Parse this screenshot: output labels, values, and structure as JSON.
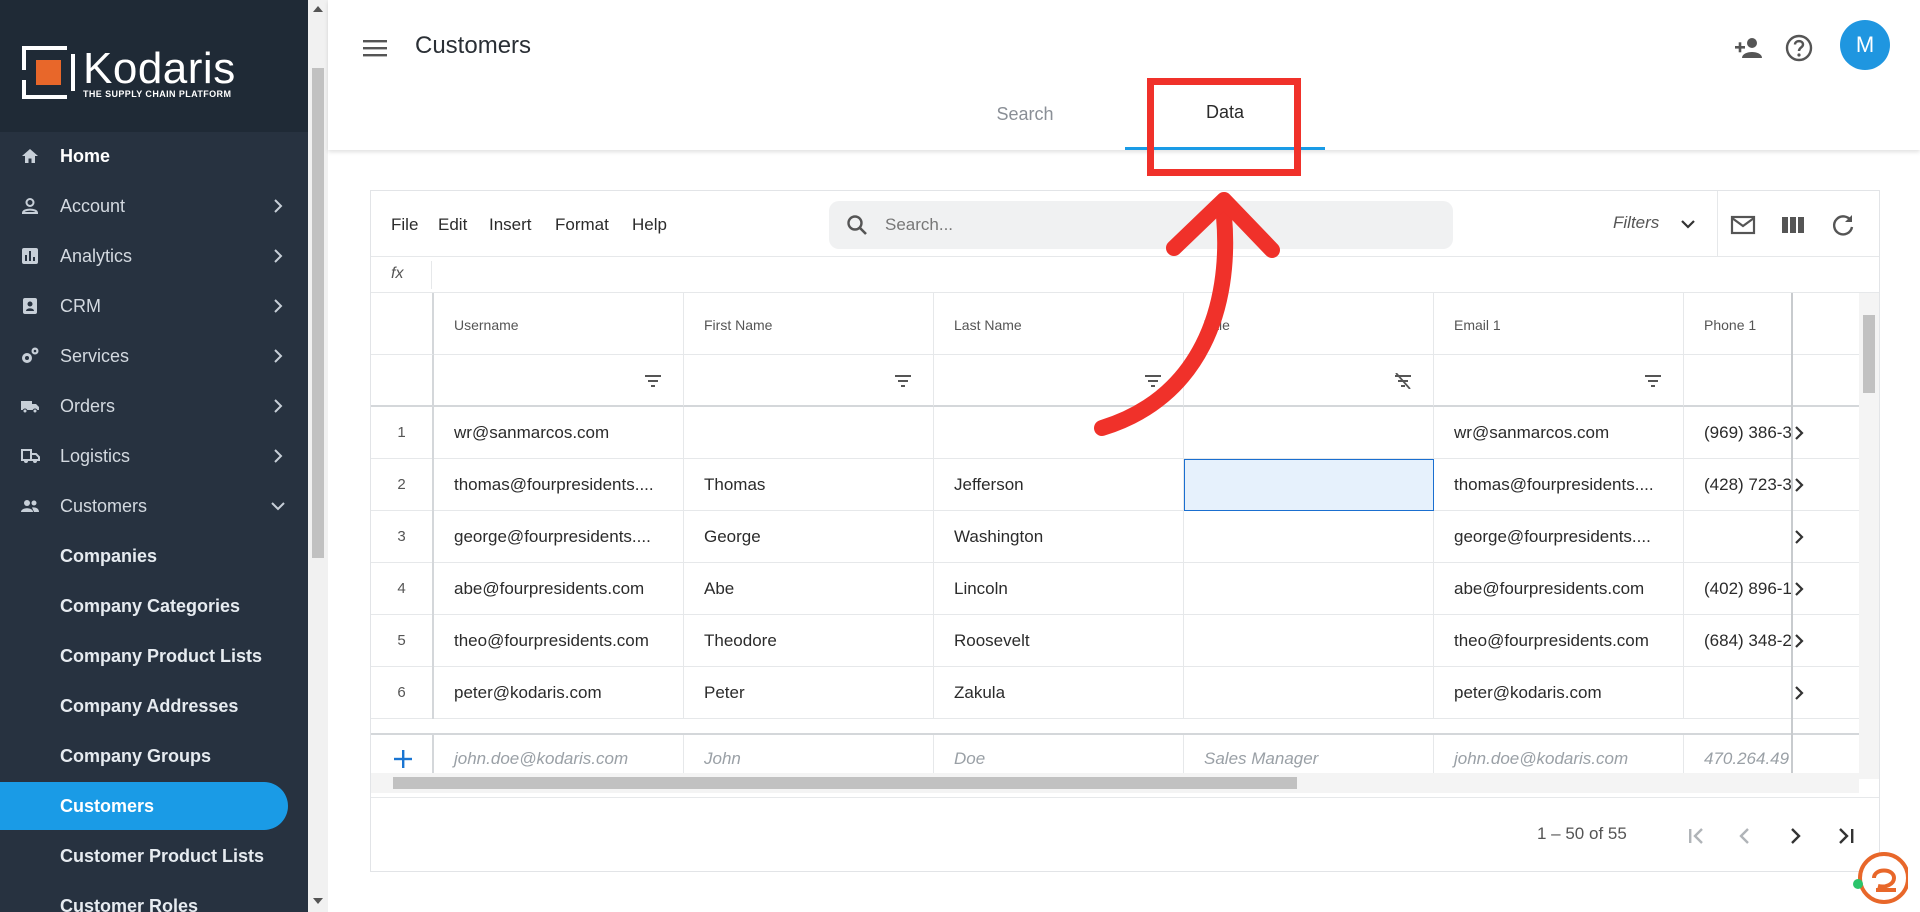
{
  "app": {
    "brand": "Kodaris",
    "tagline": "THE SUPPLY CHAIN PLATFORM",
    "page_title": "Customers",
    "avatar_letter": "M",
    "accent_color": "#1a9be6",
    "sidebar_bg": "#273240"
  },
  "sidebar": {
    "items": [
      {
        "label": "Home",
        "icon": "home-icon"
      },
      {
        "label": "Account",
        "icon": "person-icon"
      },
      {
        "label": "Analytics",
        "icon": "chart-icon"
      },
      {
        "label": "CRM",
        "icon": "contact-card-icon"
      },
      {
        "label": "Services",
        "icon": "gears-icon"
      },
      {
        "label": "Orders",
        "icon": "truck-icon"
      },
      {
        "label": "Logistics",
        "icon": "shipping-icon"
      },
      {
        "label": "Customers",
        "icon": "people-icon"
      }
    ],
    "sub_items": [
      {
        "label": "Companies"
      },
      {
        "label": "Company Categories"
      },
      {
        "label": "Company Product Lists"
      },
      {
        "label": "Company Addresses"
      },
      {
        "label": "Company Groups"
      },
      {
        "label": "Customers",
        "active": true
      },
      {
        "label": "Customer Product Lists"
      },
      {
        "label": "Customer Roles"
      }
    ]
  },
  "tabs": [
    {
      "label": "Search"
    },
    {
      "label": "Data",
      "active": true
    }
  ],
  "toolbar": {
    "menus": [
      "File",
      "Edit",
      "Insert",
      "Format",
      "Help"
    ],
    "search_placeholder": "Search...",
    "filters_label": "Filters",
    "fx_label": "fx"
  },
  "columns": [
    "Username",
    "First Name",
    "Last Name",
    "Title",
    "Email 1",
    "Phone 1"
  ],
  "rows": [
    {
      "num": "1",
      "username": "wr@sanmarcos.com",
      "first": "",
      "last": "",
      "title": "",
      "email": "wr@sanmarcos.com",
      "phone": "(969) 386-3"
    },
    {
      "num": "2",
      "username": "thomas@fourpresidents....",
      "first": "Thomas",
      "last": "Jefferson",
      "title": "",
      "email": "thomas@fourpresidents....",
      "phone": "(428) 723-3"
    },
    {
      "num": "3",
      "username": "george@fourpresidents....",
      "first": "George",
      "last": "Washington",
      "title": "",
      "email": "george@fourpresidents....",
      "phone": ""
    },
    {
      "num": "4",
      "username": "abe@fourpresidents.com",
      "first": "Abe",
      "last": "Lincoln",
      "title": "",
      "email": "abe@fourpresidents.com",
      "phone": "(402) 896-1"
    },
    {
      "num": "5",
      "username": "theo@fourpresidents.com",
      "first": "Theodore",
      "last": "Roosevelt",
      "title": "",
      "email": "theo@fourpresidents.com",
      "phone": "(684) 348-2"
    },
    {
      "num": "6",
      "username": "peter@kodaris.com",
      "first": "Peter",
      "last": "Zakula",
      "title": "",
      "email": "peter@kodaris.com",
      "phone": ""
    }
  ],
  "new_row": {
    "username": "john.doe@kodaris.com",
    "first": "John",
    "last": "Doe",
    "title": "Sales Manager",
    "email": "john.doe@kodaris.com",
    "phone": "470.264.49"
  },
  "pagination": {
    "range": "1 – 50 of 55"
  },
  "annotation": {
    "color": "#f0312a",
    "target": "tab-data"
  }
}
